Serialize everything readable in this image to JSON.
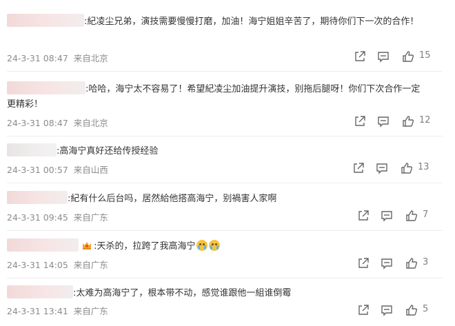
{
  "comments": [
    {
      "text": ":紀凌尘兄弟，演技需要慢慢打磨，加油！海宁姐姐辛苦了，期待你们下一次的合作！",
      "date": "24-3-31 08:47",
      "location": "来自北京",
      "likes": "15"
    },
    {
      "text": ":哈哈，海宁太不容易了！希望紀凌尘加油提升演技，别拖后腿呀！你们下次合作一定更精彩！",
      "date": "24-3-31 08:47",
      "location": "来自北京",
      "likes": "12"
    },
    {
      "text": ":高海宁真好还给传授经验",
      "date": "24-3-31 00:57",
      "location": "来自山西",
      "likes": "13"
    },
    {
      "text": ":紀有什么后台吗，居然給他搭高海宁，别禍害人家啊",
      "date": "24-3-31 09:45",
      "location": "来自广东",
      "likes": "7"
    },
    {
      "text": ":天杀的，拉跨了我高海宁",
      "date": "24-3-31 14:05",
      "location": "来自广东",
      "likes": "3"
    },
    {
      "text": ":太难为高海宁了，根本带不动，感觉谁跟他一組谁倒霉",
      "date": "24-3-31 13:41",
      "location": "来自广东",
      "likes": "5"
    }
  ],
  "icons": {
    "share": "share-icon",
    "comment": "comment-icon",
    "like": "thumbs-up-icon",
    "badge": "crown-badge-icon",
    "emoji": "crying-face-emoji"
  }
}
